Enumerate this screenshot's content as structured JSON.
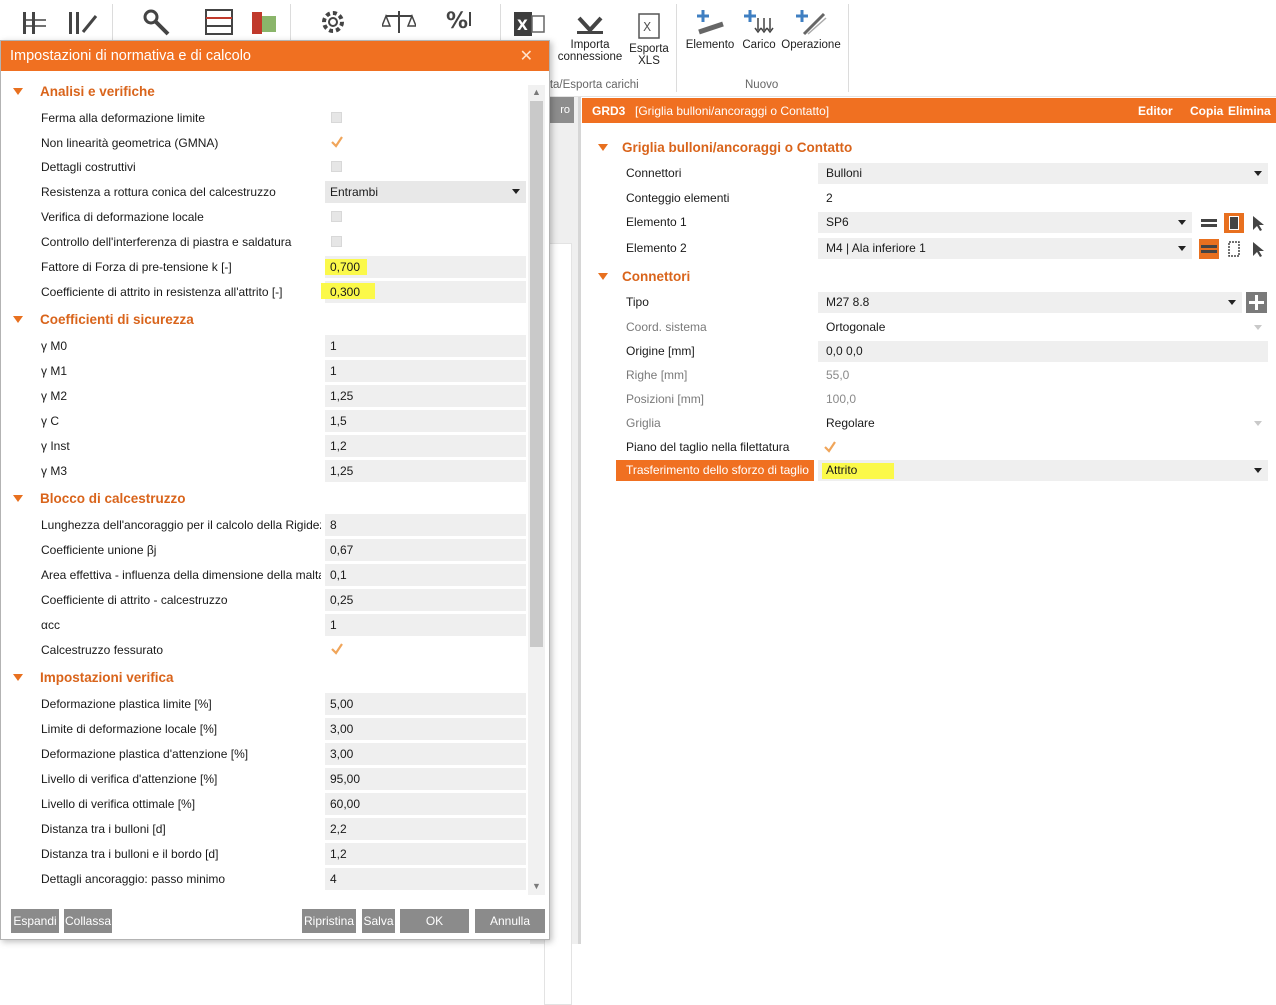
{
  "ribbon": {
    "import_label": "Importa connessione",
    "export_label": "Esporta XLS",
    "group_carichi_label": "rta/Esporta carichi",
    "new_element_label": "Elemento",
    "new_load_label": "Carico",
    "new_operation_label": "Operazione",
    "group_new_label": "Nuovo"
  },
  "bg_panel": {
    "header_text": "ro"
  },
  "right": {
    "header": {
      "id": "GRD3",
      "desc": "[Griglia bulloni/ancoraggi o Contatto]",
      "editor": "Editor",
      "copy": "Copia",
      "delete": "Elimina"
    },
    "sec1_title": "Griglia bulloni/ancoraggi o Contatto",
    "sec2_title": "Connettori",
    "connettori": {
      "label": "Connettori",
      "value": "Bulloni"
    },
    "conteggio": {
      "label": "Conteggio elementi",
      "value": "2"
    },
    "elemento1": {
      "label": "Elemento 1",
      "value": "SP6"
    },
    "elemento2": {
      "label": "Elemento 2",
      "value": "M4 | Ala inferiore 1"
    },
    "tipo": {
      "label": "Tipo",
      "value": "M27 8.8"
    },
    "coord": {
      "label": "Coord. sistema",
      "value": "Ortogonale"
    },
    "origine": {
      "label": "Origine [mm]",
      "value": "0,0 0,0"
    },
    "righe": {
      "label": "Righe [mm]",
      "value": "55,0"
    },
    "posizioni": {
      "label": "Posizioni [mm]",
      "value": "100,0"
    },
    "griglia": {
      "label": "Griglia",
      "value": "Regolare"
    },
    "piano": {
      "label": "Piano del taglio nella filettatura",
      "checked": true
    },
    "trasferimento": {
      "label": "Trasferimento dello sforzo di taglio",
      "value": "Attrito"
    }
  },
  "dialog": {
    "title": "Impostazioni di normativa e di calcolo",
    "close_glyph": "✕",
    "sections": {
      "analisi": "Analisi e verifiche",
      "sicurezza": "Coefficienti di sicurezza",
      "calcestruzzo": "Blocco di calcestruzzo",
      "verifica": "Impostazioni verifica"
    },
    "analisi": {
      "ferma": "Ferma alla deformazione limite",
      "gmna": "Non linearità geometrica (GMNA)",
      "dettagli": "Dettagli costruttivi",
      "resistenza": {
        "label": "Resistenza a rottura conica del calcestruzzo",
        "value": "Entrambi"
      },
      "deformazione_locale": "Verifica di deformazione locale",
      "interferenza": "Controllo dell'interferenza di piastra e saldatura",
      "fattore": {
        "label": "Fattore di Forza di pre-tensione k [-]",
        "value": "0,700"
      },
      "attrito": {
        "label": "Coefficiente di attrito in resistenza all'attrito [-]",
        "value": "0,300"
      }
    },
    "sicurezza": [
      {
        "label": "γ M0",
        "value": "1"
      },
      {
        "label": "γ M1",
        "value": "1"
      },
      {
        "label": "γ M2",
        "value": "1,25"
      },
      {
        "label": "γ C",
        "value": "1,5"
      },
      {
        "label": "γ Inst",
        "value": "1,2"
      },
      {
        "label": "γ M3",
        "value": "1,25"
      }
    ],
    "calcestruzzo": [
      {
        "label": "Lunghezza dell'ancoraggio per il calcolo della Rigidezza",
        "value": "8"
      },
      {
        "label": "Coefficiente unione βj",
        "value": "0,67"
      },
      {
        "label": "Area effettiva - influenza della dimensione della malta",
        "value": "0,1"
      },
      {
        "label": "Coefficiente di attrito - calcestruzzo",
        "value": "0,25"
      },
      {
        "label": "αcc",
        "value": "1"
      }
    ],
    "fessurato": "Calcestruzzo fessurato",
    "verifica": [
      {
        "label": "Deformazione plastica limite [%]",
        "value": "5,00"
      },
      {
        "label": "Limite di deformazione locale [%]",
        "value": "3,00"
      },
      {
        "label": "Deformazione plastica d'attenzione [%]",
        "value": "3,00"
      },
      {
        "label": "Livello di verifica d'attenzione [%]",
        "value": "95,00"
      },
      {
        "label": "Livello di verifica ottimale [%]",
        "value": "60,00"
      },
      {
        "label": "Distanza tra i bulloni [d]",
        "value": "2,2"
      },
      {
        "label": "Distanza tra i bulloni e il bordo [d]",
        "value": "1,2"
      },
      {
        "label": "Dettagli ancoraggio: passo minimo",
        "value": "4"
      }
    ],
    "buttons": {
      "espandi": "Espandi",
      "collassa": "Collassa",
      "ripristina": "Ripristina",
      "salva": "Salva",
      "ok": "OK",
      "annulla": "Annulla"
    }
  },
  "colors": {
    "accent": "#f07021",
    "section_text": "#d9641b",
    "highlight": "#fbf94a",
    "button_gray": "#8b8b8b"
  }
}
